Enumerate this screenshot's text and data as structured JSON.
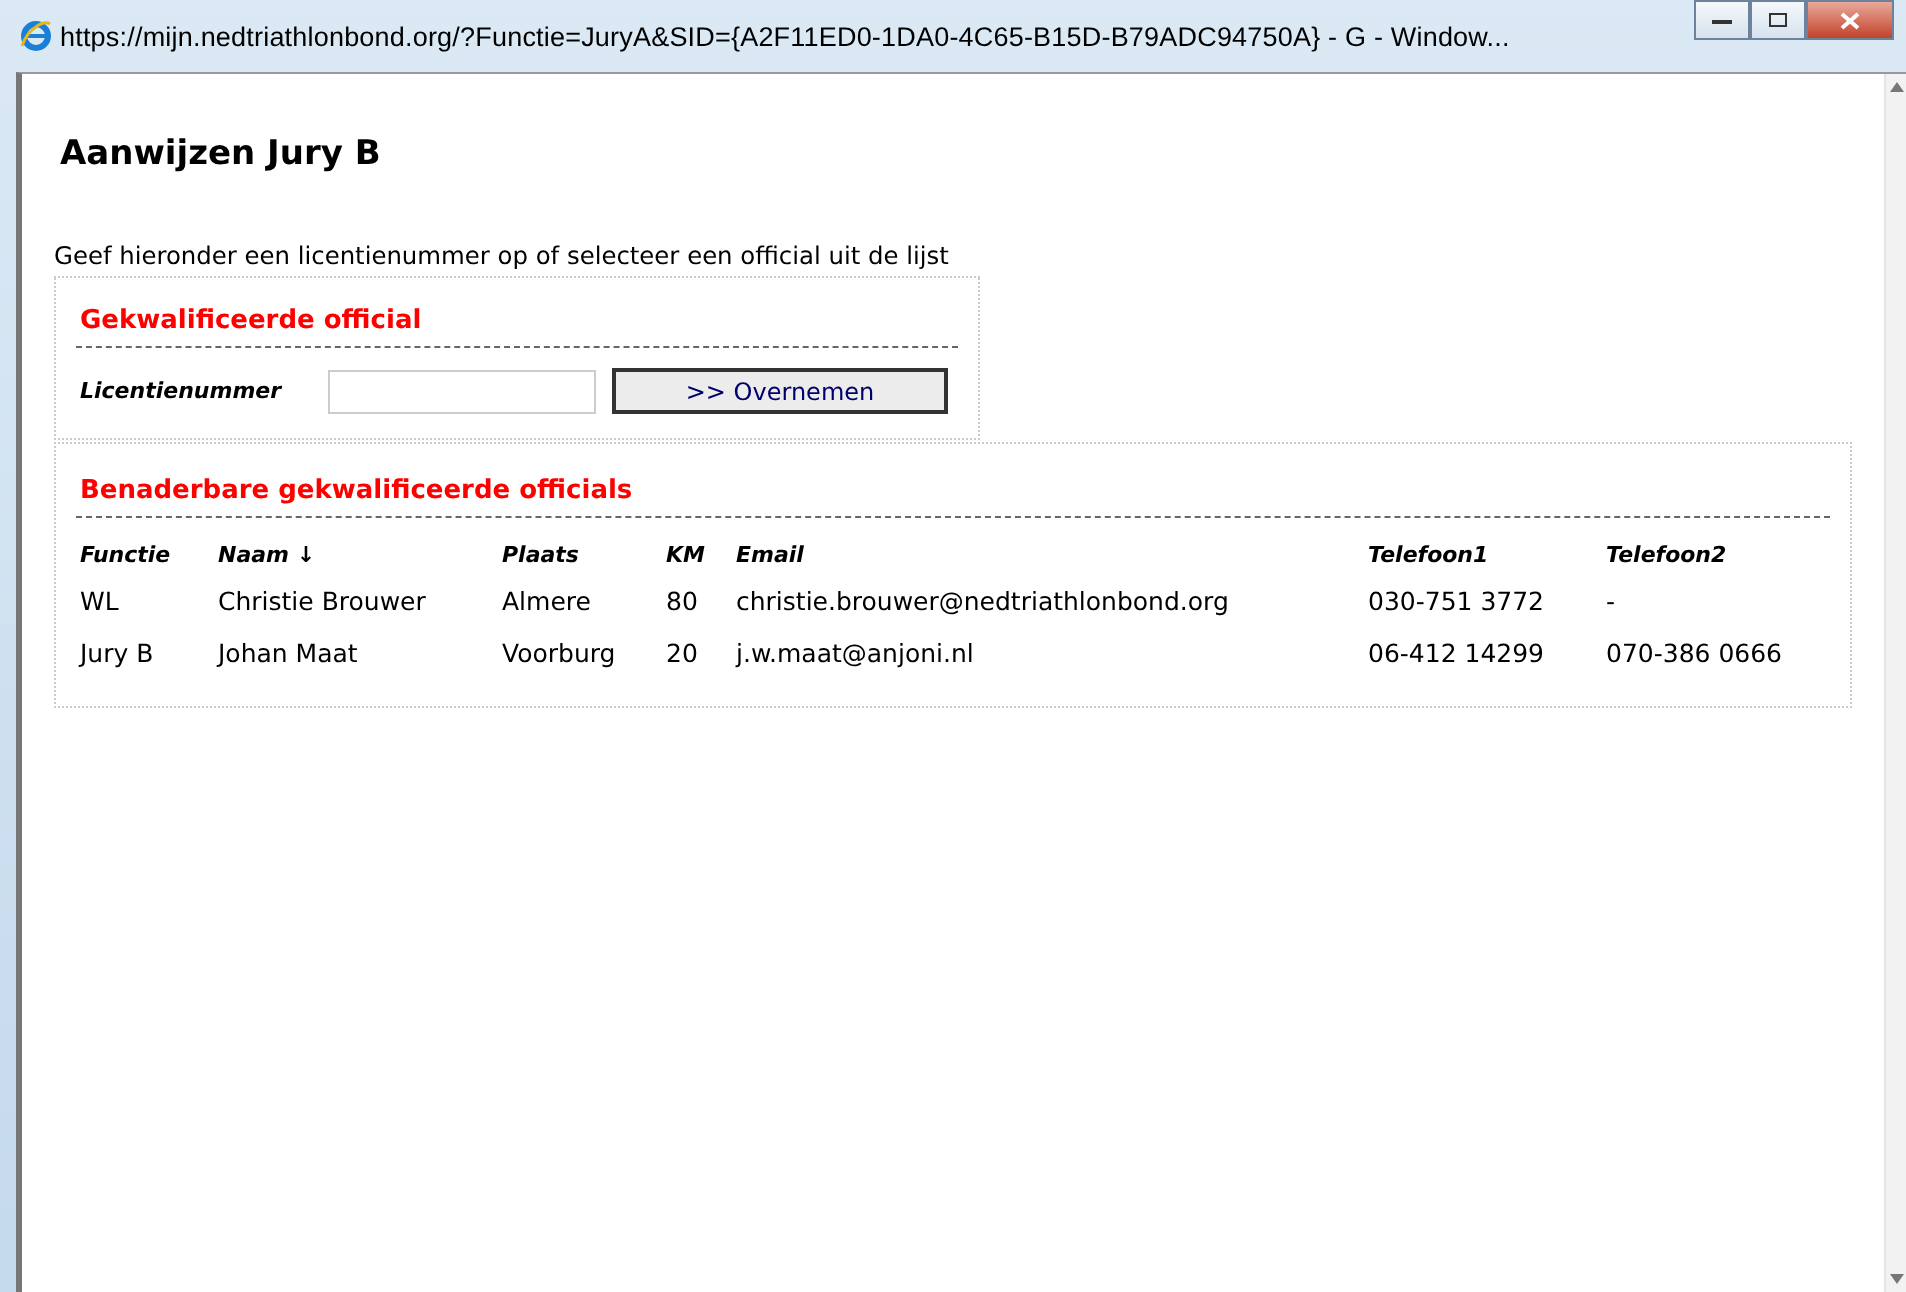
{
  "window": {
    "title": "https://mijn.nedtriathlonbond.org/?Functie=JuryA&SID={A2F11ED0-1DA0-4C65-B15D-B79ADC94750A} - G - Window..."
  },
  "page": {
    "heading": "Aanwijzen Jury B",
    "intro": "Geef hieronder een licentienummer op of selecteer een official uit de lijst"
  },
  "form": {
    "title": "Gekwalificeerde official",
    "label": "Licentienummer",
    "button": ">> Overnemen"
  },
  "table": {
    "title": "Benaderbare gekwalificeerde officials",
    "columns": [
      "Functie",
      "Naam ↓",
      "Plaats",
      "KM",
      "Email",
      "Telefoon1",
      "Telefoon2"
    ],
    "rows": [
      [
        "WL",
        "Christie Brouwer",
        "Almere",
        "80",
        "christie.brouwer@nedtriathlonbond.org",
        "030-751 3772",
        "-"
      ],
      [
        "Jury B",
        "Johan Maat",
        "Voorburg",
        "20",
        "j.w.maat@anjoni.nl",
        "06-412 14299",
        "070-386 0666"
      ]
    ]
  }
}
